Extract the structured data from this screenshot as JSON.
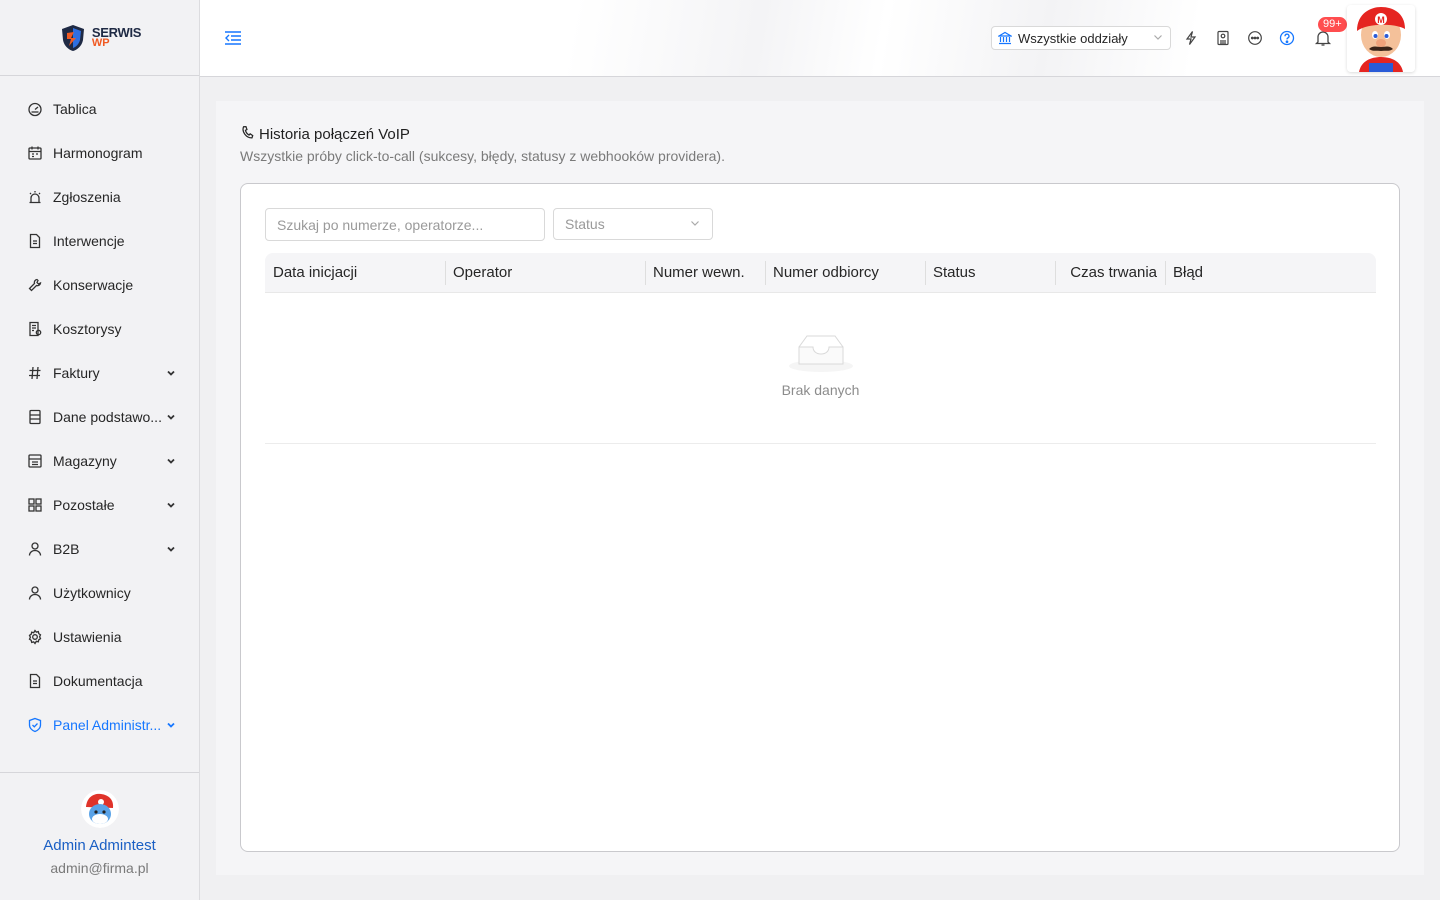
{
  "sidebar": {
    "logo": {
      "line1": "SERWIS",
      "line2": "WP"
    },
    "items": [
      {
        "label": "Tablica",
        "icon": "dashboard-icon",
        "expandable": false
      },
      {
        "label": "Harmonogram",
        "icon": "calendar-icon",
        "expandable": false
      },
      {
        "label": "Zgłoszenia",
        "icon": "alarm-icon",
        "expandable": false
      },
      {
        "label": "Interwencje",
        "icon": "document-icon",
        "expandable": false
      },
      {
        "label": "Konserwacje",
        "icon": "wrench-icon",
        "expandable": false
      },
      {
        "label": "Kosztorysy",
        "icon": "estimate-icon",
        "expandable": false
      },
      {
        "label": "Faktury",
        "icon": "hash-icon",
        "expandable": true
      },
      {
        "label": "Dane podstawo...",
        "icon": "database-icon",
        "expandable": true
      },
      {
        "label": "Magazyny",
        "icon": "warehouse-icon",
        "expandable": true
      },
      {
        "label": "Pozostałe",
        "icon": "grid-icon",
        "expandable": true
      },
      {
        "label": "B2B",
        "icon": "user-icon",
        "expandable": true
      },
      {
        "label": "Użytkownicy",
        "icon": "user-icon",
        "expandable": false
      },
      {
        "label": "Ustawienia",
        "icon": "gear-icon",
        "expandable": false
      },
      {
        "label": "Dokumentacja",
        "icon": "document-icon",
        "expandable": false
      },
      {
        "label": "Panel Administr...",
        "icon": "shield-check-icon",
        "expandable": true,
        "active": true
      }
    ],
    "user": {
      "name": "Admin Admintest",
      "email": "admin@firma.pl"
    }
  },
  "header": {
    "branch_select": {
      "value": "Wszystkie oddziały"
    },
    "notification_badge": "99+"
  },
  "page": {
    "title": "Historia połączeń VoIP",
    "subtitle": "Wszystkie próby click-to-call (sukcesy, błędy, statusy z webhooków providera)."
  },
  "filters": {
    "search_placeholder": "Szukaj po numerze, operatorze...",
    "status_placeholder": "Status"
  },
  "table": {
    "columns": [
      "Data inicjacji",
      "Operator",
      "Numer wewn.",
      "Numer odbiorcy",
      "Status",
      "Czas trwania",
      "Błąd"
    ],
    "empty_text": "Brak danych"
  },
  "colors": {
    "accent": "#1677ff",
    "badge": "#ff4d4f",
    "brand_orange": "#f05a22"
  }
}
